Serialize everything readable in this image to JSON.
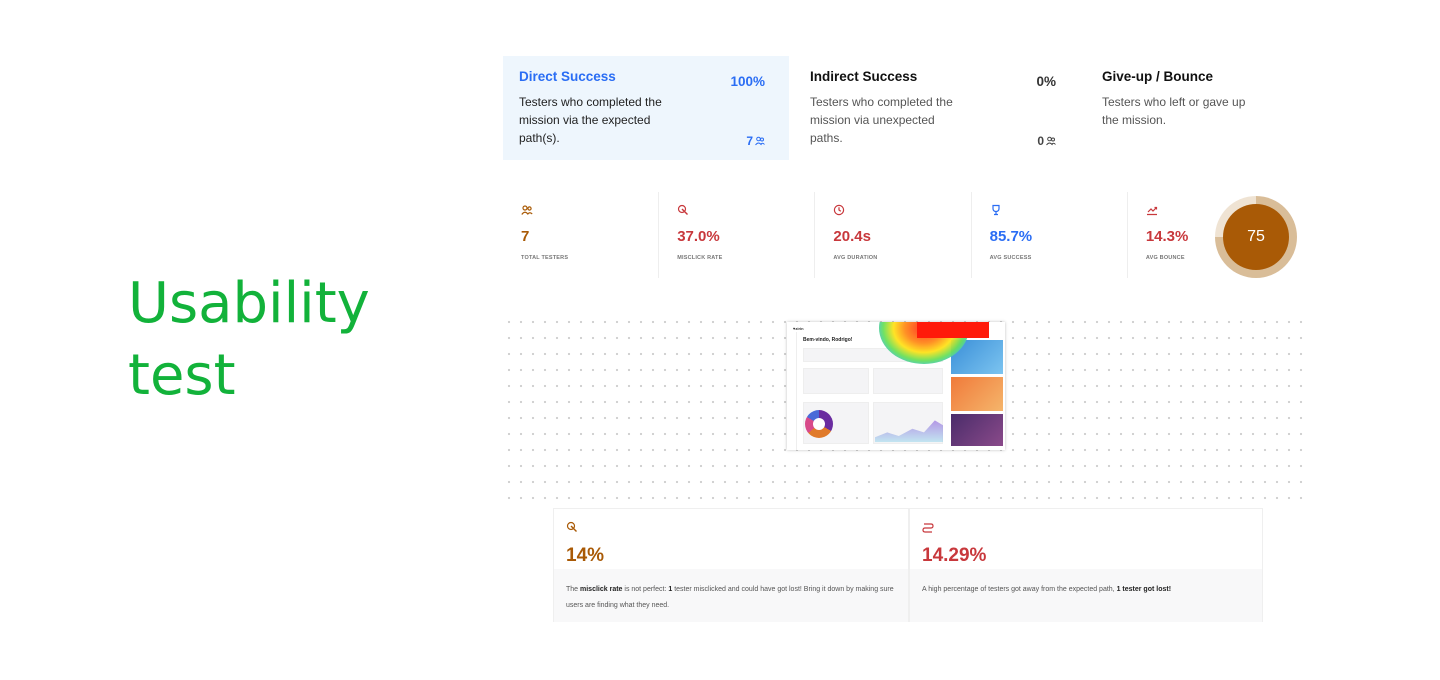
{
  "hero": {
    "line1": "Usability",
    "line2": "test"
  },
  "outcomes": [
    {
      "title": "Direct Success",
      "percent": "100%",
      "desc": "Testers who completed the mission via the expected path(s).",
      "count": "7",
      "icon": "users-icon"
    },
    {
      "title": "Indirect Success",
      "percent": "0%",
      "desc": "Testers who completed the mission via unexpected paths.",
      "count": "0",
      "icon": "users-icon"
    },
    {
      "title": "Give-up / Bounce",
      "desc": "Testers who left or gave up the mission."
    }
  ],
  "stats": [
    {
      "icon": "users-icon",
      "value": "7",
      "label": "TOTAL TESTERS",
      "color": "#a95a06"
    },
    {
      "icon": "cursor-click-icon",
      "value": "37.0%",
      "label": "MISCLICK RATE",
      "color": "#c8383c"
    },
    {
      "icon": "clock-icon",
      "value": "20.4s",
      "label": "AVG DURATION",
      "color": "#c8383c"
    },
    {
      "icon": "trophy-icon",
      "value": "85.7%",
      "label": "AVG SUCCESS",
      "color": "#2a6df4"
    },
    {
      "icon": "bounce-icon",
      "value": "14.3%",
      "label": "AVG BOUNCE",
      "color": "#c8383c"
    }
  ],
  "score": {
    "value": "75",
    "level": 0.75
  },
  "screenshot": {
    "logo": "♥zirin",
    "greeting": "Bem-vindo, Rodrigo!"
  },
  "insights": [
    {
      "icon": "cursor-click-icon",
      "value": "14%",
      "pre": "The ",
      "b1": "misclick rate",
      "mid": " is not perfect: ",
      "b2": "1",
      "post": " tester misclicked and could have got lost! Bring it down by making sure users are finding what they need."
    },
    {
      "icon": "path-icon",
      "value": "14.29%",
      "pre": "A high percentage of testers got away from the expected path, ",
      "b1": "1 tester got lost!"
    }
  ]
}
